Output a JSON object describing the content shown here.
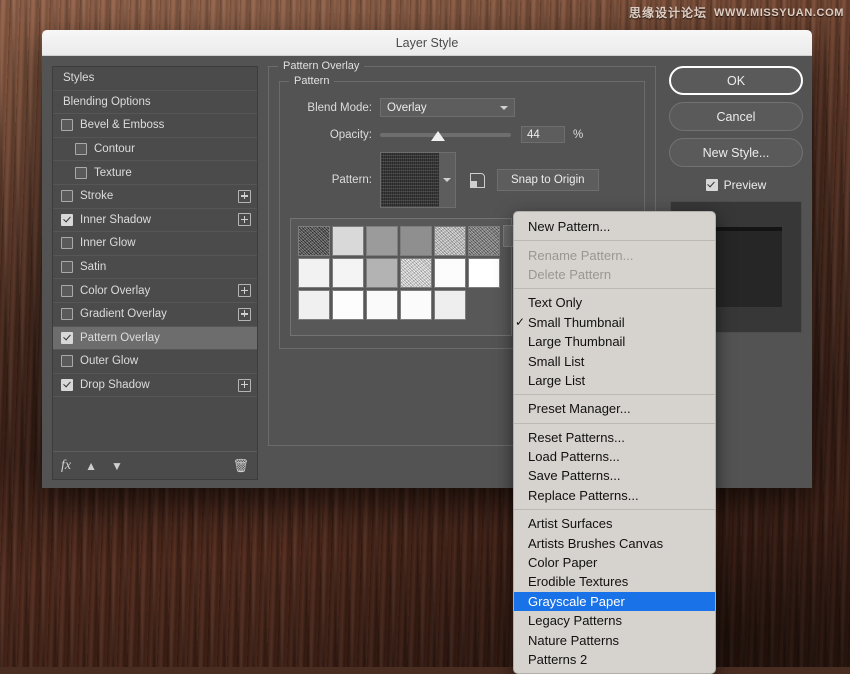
{
  "watermark": {
    "cn": "思缘设计论坛",
    "url": "WWW.MISSYUAN.COM"
  },
  "dialog": {
    "title": "Layer Style",
    "styles_list": [
      {
        "label": "Styles",
        "type": "plain",
        "checked": null,
        "plus": false,
        "selected": false
      },
      {
        "label": "Blending Options",
        "type": "plain",
        "checked": null,
        "plus": false,
        "selected": false
      },
      {
        "label": "Bevel & Emboss",
        "type": "check",
        "checked": false,
        "plus": false,
        "selected": false
      },
      {
        "label": "Contour",
        "type": "check",
        "checked": false,
        "plus": false,
        "selected": false,
        "indent": true
      },
      {
        "label": "Texture",
        "type": "check",
        "checked": false,
        "plus": false,
        "selected": false,
        "indent": true
      },
      {
        "label": "Stroke",
        "type": "check",
        "checked": false,
        "plus": true,
        "selected": false
      },
      {
        "label": "Inner Shadow",
        "type": "check",
        "checked": true,
        "plus": true,
        "selected": false
      },
      {
        "label": "Inner Glow",
        "type": "check",
        "checked": false,
        "plus": false,
        "selected": false
      },
      {
        "label": "Satin",
        "type": "check",
        "checked": false,
        "plus": false,
        "selected": false
      },
      {
        "label": "Color Overlay",
        "type": "check",
        "checked": false,
        "plus": true,
        "selected": false
      },
      {
        "label": "Gradient Overlay",
        "type": "check",
        "checked": false,
        "plus": true,
        "selected": false
      },
      {
        "label": "Pattern Overlay",
        "type": "check",
        "checked": true,
        "plus": false,
        "selected": true
      },
      {
        "label": "Outer Glow",
        "type": "check",
        "checked": false,
        "plus": false,
        "selected": false
      },
      {
        "label": "Drop Shadow",
        "type": "check",
        "checked": true,
        "plus": true,
        "selected": false
      }
    ],
    "list_tools": {
      "fx": "fx",
      "move_up": "▲",
      "move_down": "▼",
      "delete": "🗑"
    },
    "pattern_overlay": {
      "group_label": "Pattern Overlay",
      "subgroup_label": "Pattern",
      "blend_mode_label": "Blend Mode:",
      "blend_mode_value": "Overlay",
      "opacity_label": "Opacity:",
      "opacity_value": "44",
      "opacity_percent_sign": "%",
      "opacity_fraction": 44,
      "pattern_label": "Pattern:",
      "snap_to_origin_label": "Snap to Origin"
    },
    "swatches": [
      "#3b3b3b",
      "#d9d9d9",
      "#9b9b9b",
      "#8f8f8f",
      "#c8c8c8",
      "#737373",
      "#f2f2f2",
      "#f4f4f4",
      "#b3b3b3",
      "#e4e4e4",
      "#fcfcfc",
      "#ffffff",
      "#f0f0f0",
      "#fdfdfd",
      "#fafafa",
      "#fbfbfb",
      "#eeeeee"
    ],
    "buttons": {
      "ok": "OK",
      "cancel": "Cancel",
      "new_style": "New Style...",
      "preview_label": "Preview",
      "preview_checked": true
    }
  },
  "context_menu": {
    "items": [
      {
        "label": "New Pattern...",
        "state": "normal",
        "checked": false
      },
      {
        "sep": true
      },
      {
        "label": "Rename Pattern...",
        "state": "disabled",
        "checked": false
      },
      {
        "label": "Delete Pattern",
        "state": "disabled",
        "checked": false
      },
      {
        "sep": true
      },
      {
        "label": "Text Only",
        "state": "normal",
        "checked": false
      },
      {
        "label": "Small Thumbnail",
        "state": "normal",
        "checked": true
      },
      {
        "label": "Large Thumbnail",
        "state": "normal",
        "checked": false
      },
      {
        "label": "Small List",
        "state": "normal",
        "checked": false
      },
      {
        "label": "Large List",
        "state": "normal",
        "checked": false
      },
      {
        "sep": true
      },
      {
        "label": "Preset Manager...",
        "state": "normal",
        "checked": false
      },
      {
        "sep": true
      },
      {
        "label": "Reset Patterns...",
        "state": "normal",
        "checked": false
      },
      {
        "label": "Load Patterns...",
        "state": "normal",
        "checked": false
      },
      {
        "label": "Save Patterns...",
        "state": "normal",
        "checked": false
      },
      {
        "label": "Replace Patterns...",
        "state": "normal",
        "checked": false
      },
      {
        "sep": true
      },
      {
        "label": "Artist Surfaces",
        "state": "normal",
        "checked": false
      },
      {
        "label": "Artists Brushes Canvas",
        "state": "normal",
        "checked": false
      },
      {
        "label": "Color Paper",
        "state": "normal",
        "checked": false
      },
      {
        "label": "Erodible Textures",
        "state": "normal",
        "checked": false
      },
      {
        "label": "Grayscale Paper",
        "state": "highlighted",
        "checked": false
      },
      {
        "label": "Legacy Patterns",
        "state": "normal",
        "checked": false
      },
      {
        "label": "Nature Patterns",
        "state": "normal",
        "checked": false
      },
      {
        "label": "Patterns 2",
        "state": "normal",
        "checked": false
      }
    ],
    "check_glyph": "✓",
    "highlight_color": "#1a72e8"
  }
}
